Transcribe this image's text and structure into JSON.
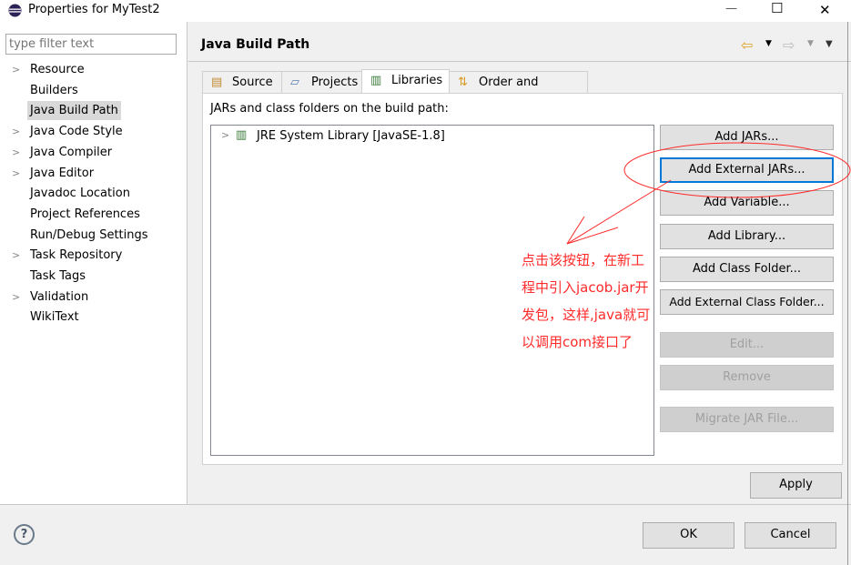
{
  "window": {
    "title": "Properties for MyTest2",
    "minimize": "—",
    "maximize": "☐",
    "close": "✕"
  },
  "filter": {
    "placeholder": "type filter text"
  },
  "tree": [
    {
      "label": "Resource",
      "expandable": true
    },
    {
      "label": "Builders",
      "expandable": false
    },
    {
      "label": "Java Build Path",
      "expandable": false,
      "selected": true
    },
    {
      "label": "Java Code Style",
      "expandable": true
    },
    {
      "label": "Java Compiler",
      "expandable": true
    },
    {
      "label": "Java Editor",
      "expandable": true
    },
    {
      "label": "Javadoc Location",
      "expandable": false
    },
    {
      "label": "Project References",
      "expandable": false
    },
    {
      "label": "Run/Debug Settings",
      "expandable": false
    },
    {
      "label": "Task Repository",
      "expandable": true
    },
    {
      "label": "Task Tags",
      "expandable": false
    },
    {
      "label": "Validation",
      "expandable": true
    },
    {
      "label": "WikiText",
      "expandable": false
    }
  ],
  "header": {
    "title": "Java Build Path"
  },
  "tabs": [
    {
      "label": "Source"
    },
    {
      "label": "Projects"
    },
    {
      "label": "Libraries",
      "active": true
    },
    {
      "label": "Order and Export"
    }
  ],
  "libraries": {
    "caption": "JARs and class folders on the build path:",
    "entries": [
      {
        "label": "JRE System Library [JavaSE-1.8]"
      }
    ],
    "buttons": {
      "add_jars": "Add JARs...",
      "add_external_jars": "Add External JARs...",
      "add_variable": "Add Variable...",
      "add_library": "Add Library...",
      "add_class_folder": "Add Class Folder...",
      "add_external_class_folder": "Add External Class Folder...",
      "edit": "Edit...",
      "remove": "Remove",
      "migrate": "Migrate JAR File..."
    }
  },
  "annotation": {
    "color": "#ff2a2a",
    "lines": [
      "点击该按钮，在新工",
      "程中引入jacob.jar开",
      "发包，这样,java就可",
      "以调用com接口了"
    ]
  },
  "footer": {
    "apply": "Apply",
    "ok": "OK",
    "cancel": "Cancel",
    "help": "?"
  }
}
